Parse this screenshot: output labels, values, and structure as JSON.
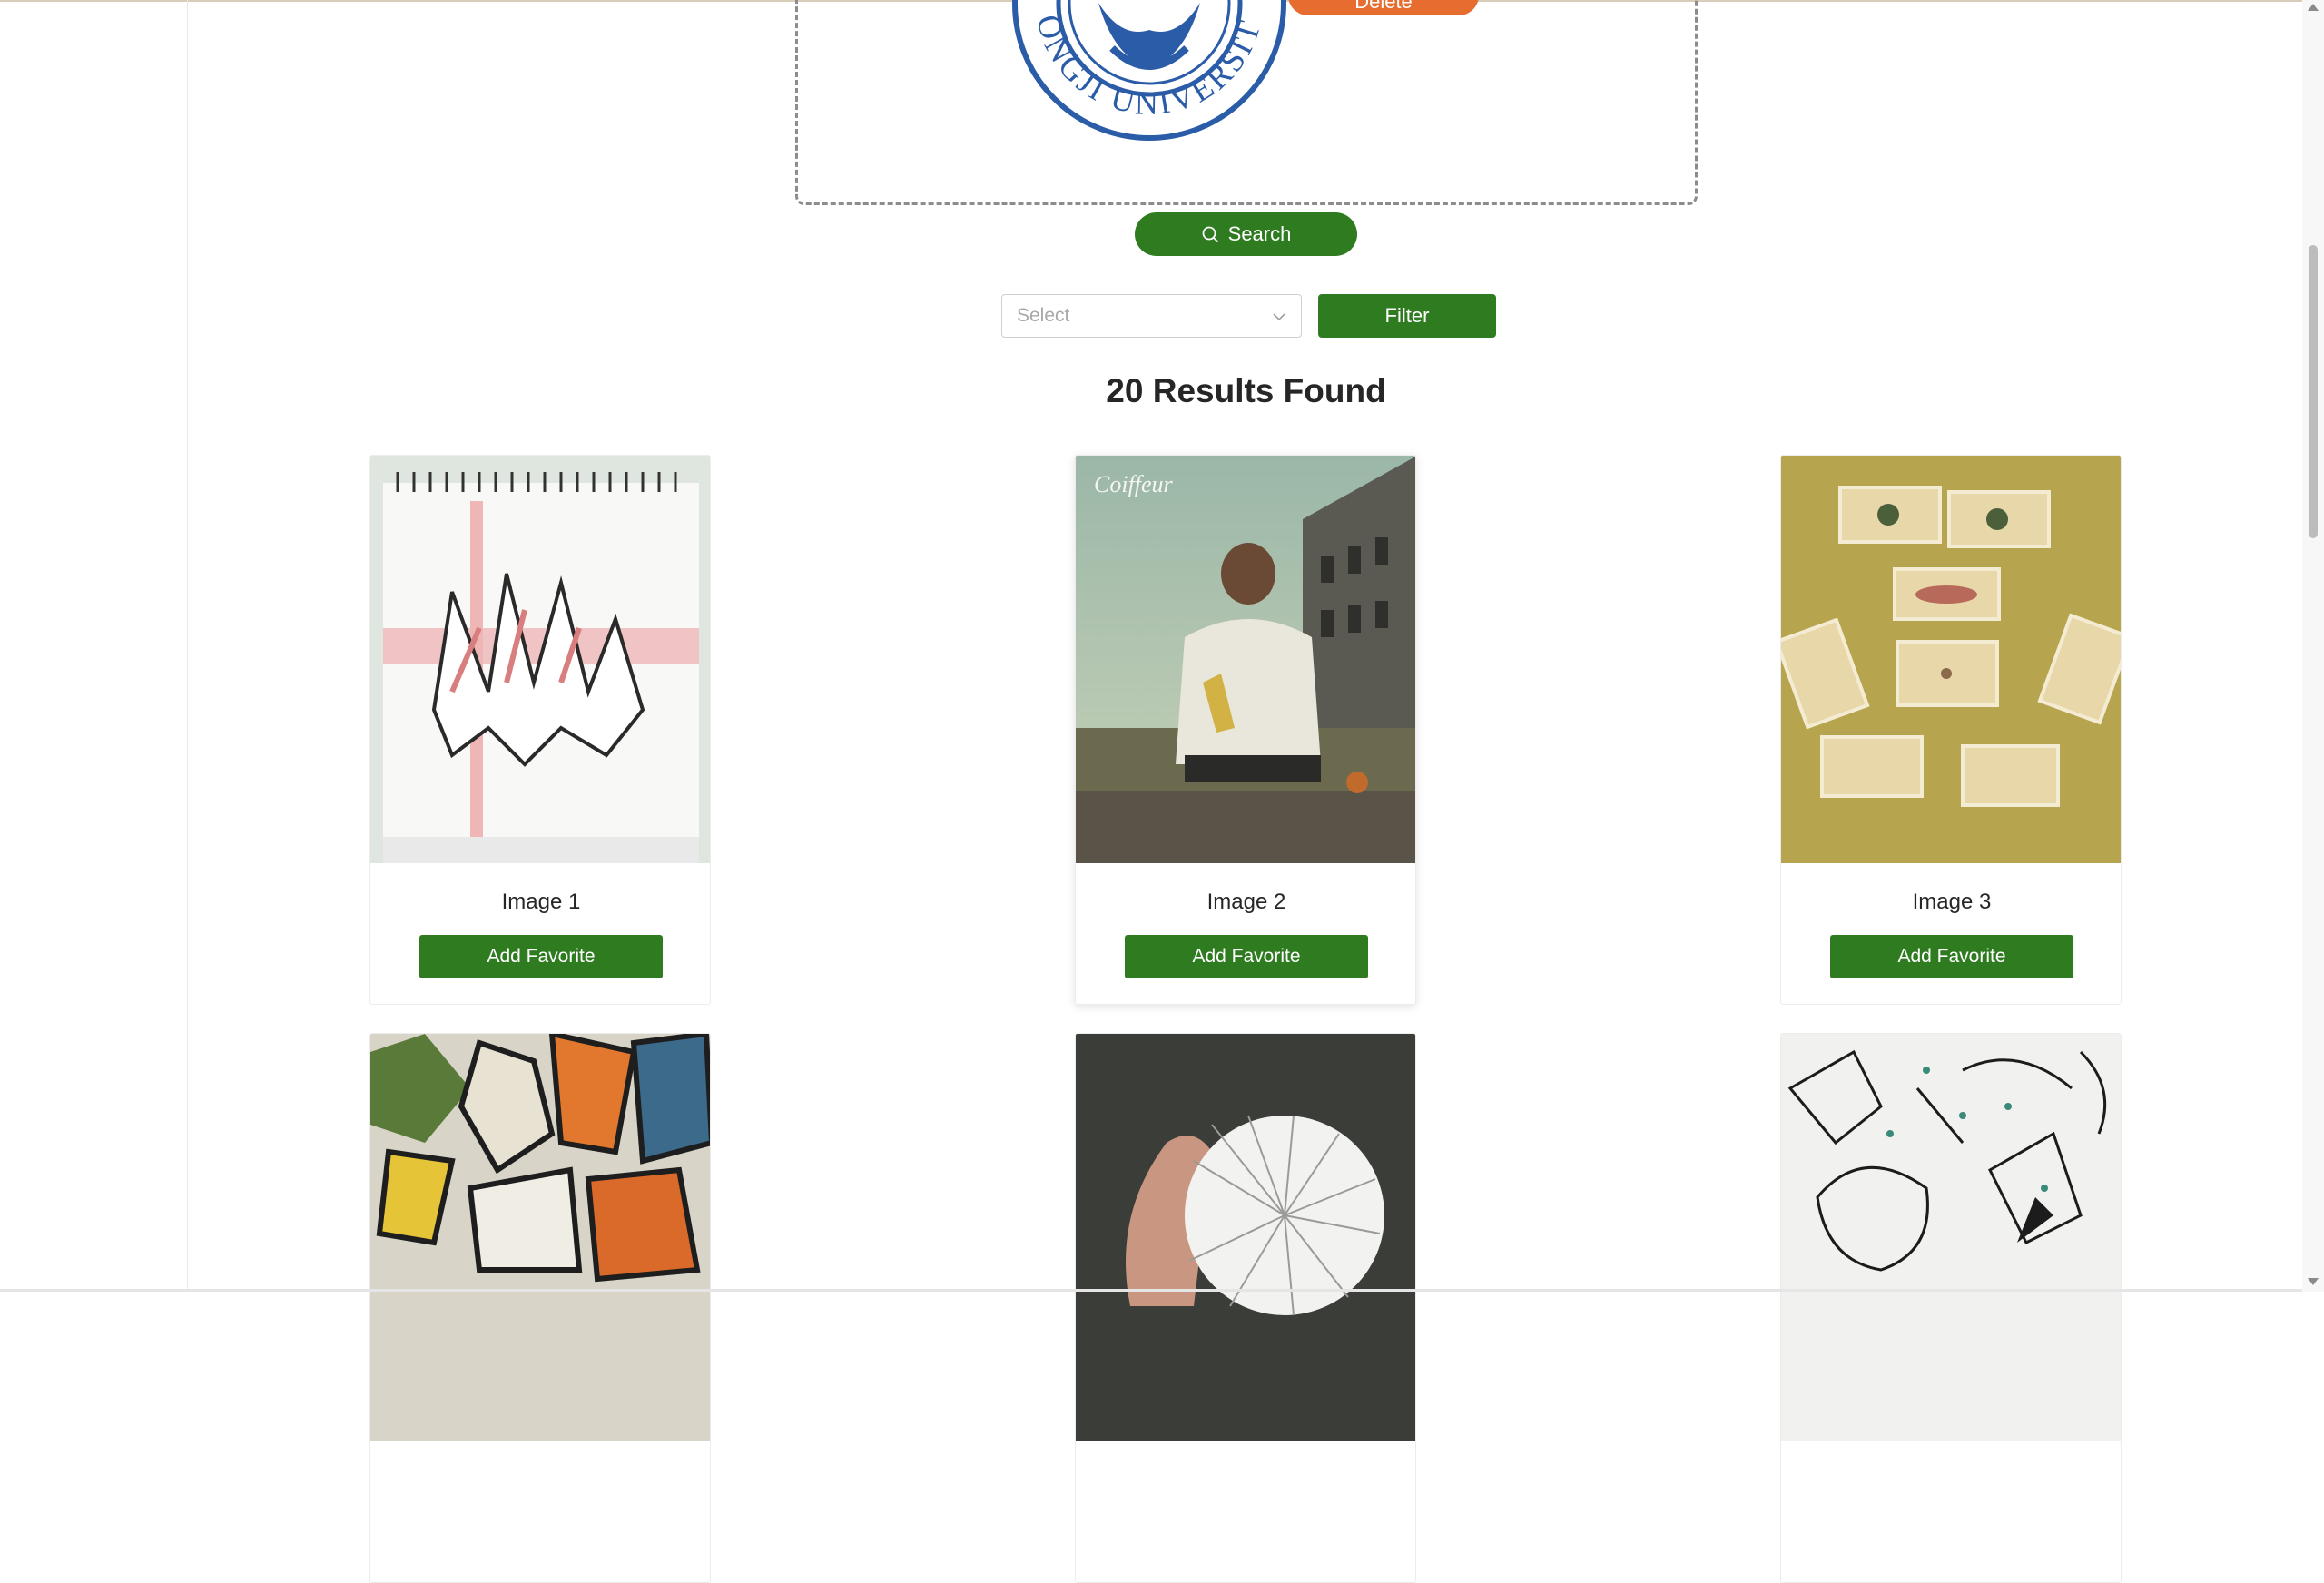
{
  "colors": {
    "primary_green": "#2e7b20",
    "delete_orange": "#e66d2f",
    "seal_blue": "#2b5ca8"
  },
  "upload": {
    "seal_text": "TONGJI UNIVERSITY",
    "seal_icon": "tongji-university-seal",
    "delete_label": "Delete"
  },
  "search": {
    "label": "Search",
    "icon": "search-icon"
  },
  "filter": {
    "select_placeholder": "Select",
    "button_label": "Filter"
  },
  "results": {
    "title": "20 Results Found",
    "cards": [
      {
        "caption": "Image 1",
        "button": "Add Favorite",
        "image": "graffiti-sketchbook"
      },
      {
        "caption": "Image 2",
        "button": "Add Favorite",
        "image": "coiffeur-ad-man-sitting",
        "thumb_text": "Coiffeur"
      },
      {
        "caption": "Image 3",
        "button": "Add Favorite",
        "image": "face-photo-collage"
      },
      {
        "caption": "",
        "button": "",
        "image": "graffiti-wall"
      },
      {
        "caption": "",
        "button": "",
        "image": "hand-holding-paper-spiral"
      },
      {
        "caption": "",
        "button": "",
        "image": "black-white-graffiti-drawing"
      }
    ]
  }
}
